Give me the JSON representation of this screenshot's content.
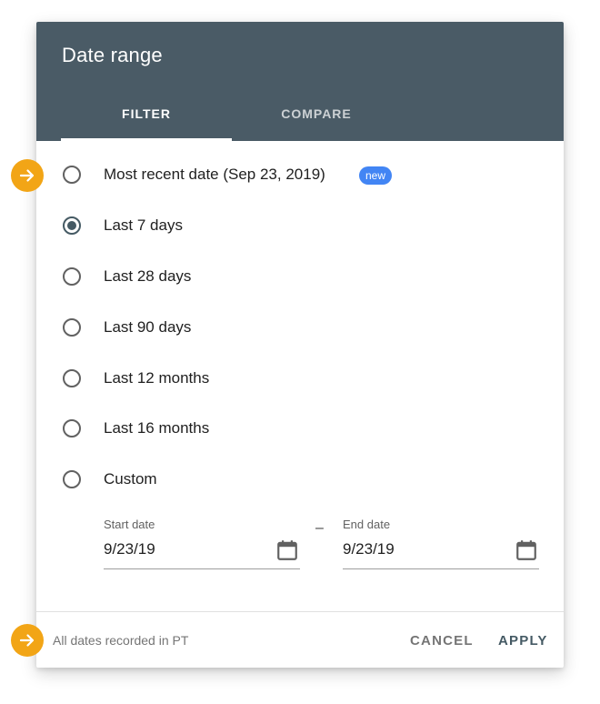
{
  "dialog": {
    "title": "Date range",
    "tabs": [
      {
        "label": "FILTER",
        "selected": true
      },
      {
        "label": "COMPARE",
        "selected": false
      }
    ],
    "colors": {
      "header": "#4a5b66",
      "accent": "#455a64",
      "badge": "#4285f4",
      "callout": "#f2a516"
    }
  },
  "options": [
    {
      "label": "Most recent date (Sep 23, 2019)",
      "badge": "new",
      "checked": false
    },
    {
      "label": "Last 7 days",
      "checked": true
    },
    {
      "label": "Last 28 days",
      "checked": false
    },
    {
      "label": "Last 90 days",
      "checked": false
    },
    {
      "label": "Last 12 months",
      "checked": false
    },
    {
      "label": "Last 16 months",
      "checked": false
    },
    {
      "label": "Custom",
      "checked": false
    }
  ],
  "custom_range": {
    "start": {
      "label": "Start date",
      "value": "9/23/19",
      "icon": "calendar-icon"
    },
    "separator": "–",
    "end": {
      "label": "End date",
      "value": "9/23/19",
      "icon": "calendar-icon"
    }
  },
  "footer": {
    "note": "All dates recorded in PT",
    "cancel_label": "CANCEL",
    "apply_label": "APPLY"
  },
  "callouts": [
    {
      "icon": "arrow-right-icon"
    },
    {
      "icon": "arrow-right-icon"
    }
  ]
}
